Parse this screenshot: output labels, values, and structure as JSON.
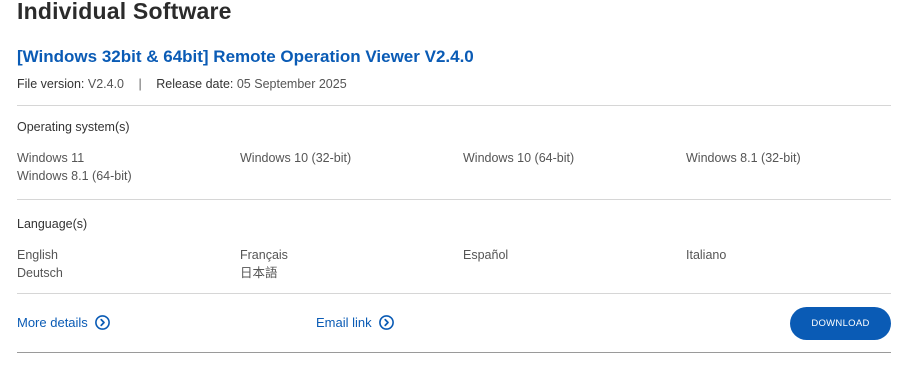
{
  "page": {
    "title": "Individual Software"
  },
  "product": {
    "title": "[Windows 32bit & 64bit] Remote Operation Viewer V2.4.0",
    "file_version_label": "File version:",
    "file_version": "V2.4.0",
    "separator": "|",
    "release_date_label": "Release date:",
    "release_date": "05 September 2025"
  },
  "os_section": {
    "label": "Operating system(s)",
    "items": [
      "Windows 11",
      "Windows 10 (32-bit)",
      "Windows 10 (64-bit)",
      "Windows 8.1 (32-bit)",
      "Windows 8.1 (64-bit)"
    ]
  },
  "language_section": {
    "label": "Language(s)",
    "items": [
      "English",
      "Français",
      "Español",
      "Italiano",
      "Deutsch",
      "日本語"
    ]
  },
  "actions": {
    "more_details_label": "More details",
    "email_link_label": "Email link",
    "download_label": "DOWNLOAD",
    "link_icon": "chevron-right-circle-icon",
    "accent_color": "#0a5bb5"
  }
}
